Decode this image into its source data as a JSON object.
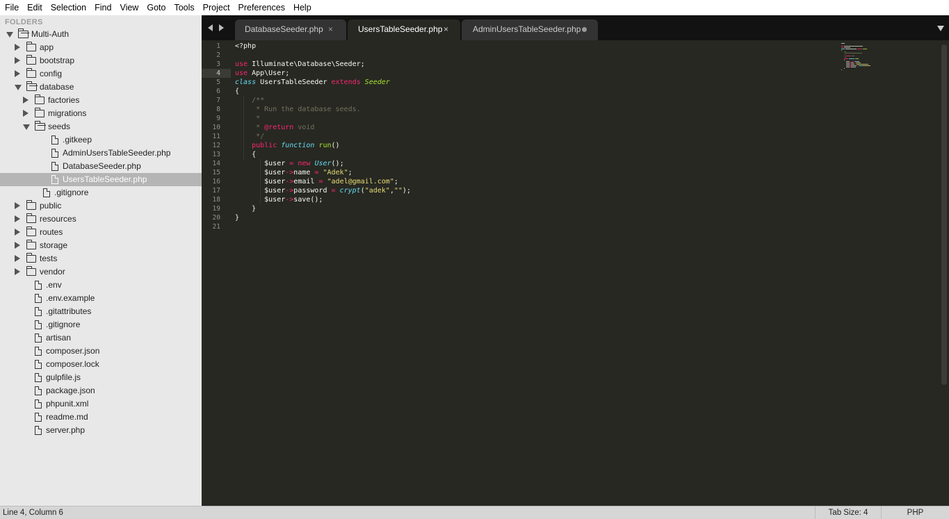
{
  "menu": [
    "File",
    "Edit",
    "Selection",
    "Find",
    "View",
    "Goto",
    "Tools",
    "Project",
    "Preferences",
    "Help"
  ],
  "sidebar": {
    "title": "FOLDERS",
    "tree": [
      {
        "label": "Multi-Auth",
        "type": "folder",
        "state": "open",
        "depth": 0
      },
      {
        "label": "app",
        "type": "folder",
        "state": "closed",
        "depth": 1
      },
      {
        "label": "bootstrap",
        "type": "folder",
        "state": "closed",
        "depth": 1
      },
      {
        "label": "config",
        "type": "folder",
        "state": "closed",
        "depth": 1
      },
      {
        "label": "database",
        "type": "folder",
        "state": "open",
        "depth": 1
      },
      {
        "label": "factories",
        "type": "folder",
        "state": "closed",
        "depth": 2
      },
      {
        "label": "migrations",
        "type": "folder",
        "state": "closed",
        "depth": 2
      },
      {
        "label": "seeds",
        "type": "folder",
        "state": "open",
        "depth": 2
      },
      {
        "label": ".gitkeep",
        "type": "file",
        "depth": 3
      },
      {
        "label": "AdminUsersTableSeeder.php",
        "type": "file",
        "depth": 3
      },
      {
        "label": "DatabaseSeeder.php",
        "type": "file",
        "depth": 3
      },
      {
        "label": "UsersTableSeeder.php",
        "type": "file",
        "depth": 3,
        "selected": true
      },
      {
        "label": ".gitignore",
        "type": "file",
        "depth": 2
      },
      {
        "label": "public",
        "type": "folder",
        "state": "closed",
        "depth": 1
      },
      {
        "label": "resources",
        "type": "folder",
        "state": "closed",
        "depth": 1
      },
      {
        "label": "routes",
        "type": "folder",
        "state": "closed",
        "depth": 1
      },
      {
        "label": "storage",
        "type": "folder",
        "state": "closed",
        "depth": 1
      },
      {
        "label": "tests",
        "type": "folder",
        "state": "closed",
        "depth": 1
      },
      {
        "label": "vendor",
        "type": "folder",
        "state": "closed",
        "depth": 1
      },
      {
        "label": ".env",
        "type": "file",
        "depth": 1
      },
      {
        "label": ".env.example",
        "type": "file",
        "depth": 1
      },
      {
        "label": ".gitattributes",
        "type": "file",
        "depth": 1
      },
      {
        "label": ".gitignore",
        "type": "file",
        "depth": 1
      },
      {
        "label": "artisan",
        "type": "file",
        "depth": 1
      },
      {
        "label": "composer.json",
        "type": "file",
        "depth": 1
      },
      {
        "label": "composer.lock",
        "type": "file",
        "depth": 1
      },
      {
        "label": "gulpfile.js",
        "type": "file",
        "depth": 1
      },
      {
        "label": "package.json",
        "type": "file",
        "depth": 1
      },
      {
        "label": "phpunit.xml",
        "type": "file",
        "depth": 1
      },
      {
        "label": "readme.md",
        "type": "file",
        "depth": 1
      },
      {
        "label": "server.php",
        "type": "file",
        "depth": 1
      }
    ]
  },
  "tabs": [
    {
      "label": "DatabaseSeeder.php",
      "close": "×"
    },
    {
      "label": "UsersTableSeeder.php",
      "close": "×",
      "active": true
    },
    {
      "label": "AdminUsersTableSeeder.php",
      "dirty": true
    }
  ],
  "editor": {
    "active_line": 4,
    "lines": [
      [
        [
          "",
          "<?php"
        ]
      ],
      [],
      [
        [
          "kw",
          "use"
        ],
        [
          "",
          " Illuminate\\Database\\Seeder;"
        ]
      ],
      [
        [
          "kw",
          "use"
        ],
        [
          "",
          " App\\User;"
        ]
      ],
      [
        [
          "kwi",
          "class"
        ],
        [
          "",
          " UsersTableSeeder "
        ],
        [
          "kw",
          "extends"
        ],
        [
          "",
          " "
        ],
        [
          "cls",
          "Seeder"
        ]
      ],
      [
        [
          "",
          "{"
        ]
      ],
      [
        [
          "",
          "    "
        ],
        [
          "cmt",
          "/**"
        ]
      ],
      [
        [
          "",
          "    "
        ],
        [
          "cmt",
          " * Run the database seeds."
        ]
      ],
      [
        [
          "",
          "    "
        ],
        [
          "cmt",
          " *"
        ]
      ],
      [
        [
          "",
          "    "
        ],
        [
          "cmt",
          " * "
        ],
        [
          "kw",
          "@return"
        ],
        [
          "cmt",
          " void"
        ]
      ],
      [
        [
          "",
          "    "
        ],
        [
          "cmt",
          " */"
        ]
      ],
      [
        [
          "",
          "    "
        ],
        [
          "kw",
          "public"
        ],
        [
          "",
          " "
        ],
        [
          "kwi",
          "function"
        ],
        [
          "",
          " "
        ],
        [
          "fn",
          "run"
        ],
        [
          "",
          "()"
        ]
      ],
      [
        [
          "",
          "    {"
        ]
      ],
      [
        [
          "",
          "       $user "
        ],
        [
          "op",
          "="
        ],
        [
          "",
          " "
        ],
        [
          "kw",
          "new"
        ],
        [
          "",
          " "
        ],
        [
          "kwi",
          "User"
        ],
        [
          "",
          "();"
        ]
      ],
      [
        [
          "",
          "       $user"
        ],
        [
          "op",
          "->"
        ],
        [
          "",
          "name "
        ],
        [
          "op",
          "="
        ],
        [
          "",
          " "
        ],
        [
          "str",
          "\"Adek\""
        ],
        [
          "",
          ";"
        ]
      ],
      [
        [
          "",
          "       $user"
        ],
        [
          "op",
          "->"
        ],
        [
          "",
          "email "
        ],
        [
          "op",
          "="
        ],
        [
          "",
          " "
        ],
        [
          "str",
          "\"adel@gmail.com\""
        ],
        [
          "",
          ";"
        ]
      ],
      [
        [
          "",
          "       $user"
        ],
        [
          "op",
          "->"
        ],
        [
          "",
          "password "
        ],
        [
          "op",
          "="
        ],
        [
          "",
          " "
        ],
        [
          "kwi",
          "crypt"
        ],
        [
          "",
          "("
        ],
        [
          "str",
          "\"adek\""
        ],
        [
          "",
          ","
        ],
        [
          "str",
          "\"\""
        ],
        [
          "",
          ");"
        ]
      ],
      [
        [
          "",
          "       $user"
        ],
        [
          "op",
          "->"
        ],
        [
          "",
          "save();"
        ]
      ],
      [
        [
          "",
          "    }"
        ]
      ],
      [
        [
          "",
          "}"
        ]
      ],
      []
    ]
  },
  "status": {
    "position": "Line 4, Column 6",
    "tab_size": "Tab Size: 4",
    "syntax": "PHP"
  },
  "colors": {
    "editor_bg": "#272822",
    "sidebar_bg": "#e8e8e8",
    "keyword": "#f92672",
    "storage": "#66d9ef",
    "class": "#a6e22e",
    "string": "#e6db74",
    "comment": "#75715e"
  }
}
